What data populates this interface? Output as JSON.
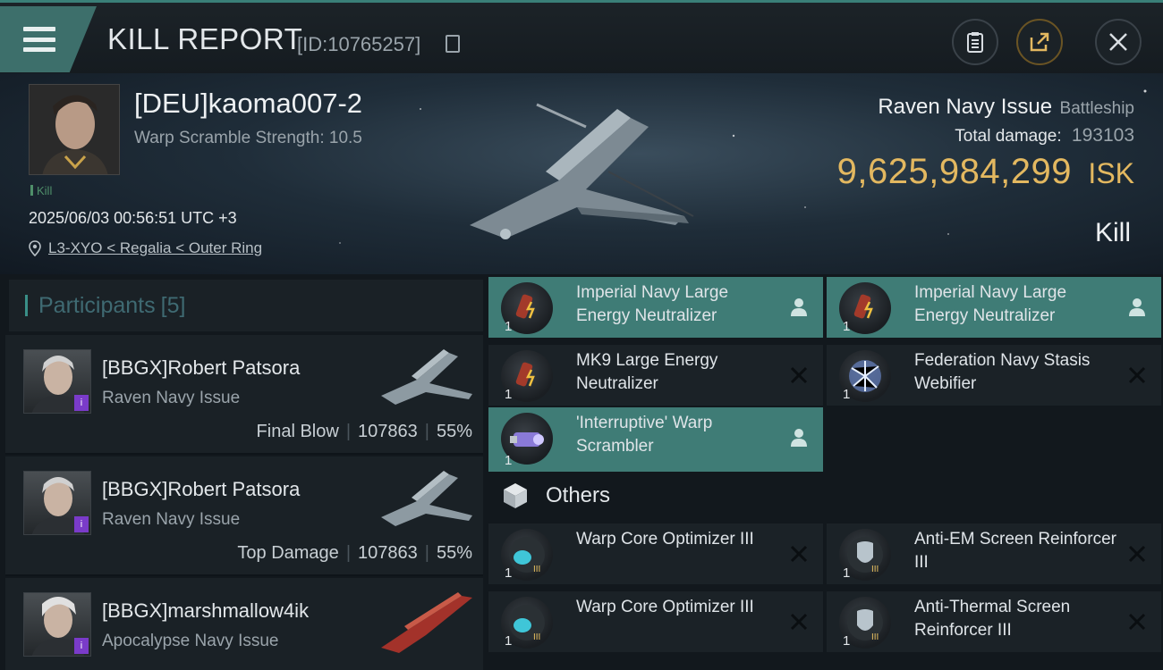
{
  "header": {
    "title": "KILL REPORT",
    "id_text": "[ID:10765257]"
  },
  "victim": {
    "name": "[DEU]kaoma007-2",
    "subtitle": "Warp Scramble Strength: 10.5",
    "tag": "Kill",
    "datetime": "2025/06/03 00:56:51 UTC +3",
    "location": "L3-XYO < Regalia < Outer Ring",
    "ship_name": "Raven Navy Issue",
    "ship_class": "Battleship",
    "total_damage_label": "Total damage:",
    "total_damage": "193103",
    "isk_value": "9,625,984,299",
    "isk_unit": "ISK",
    "result": "Kill"
  },
  "participants": {
    "title": "Participants",
    "count": "[5]",
    "rows": [
      {
        "name": "[BBGX]Robert Patsora",
        "ship": "Raven Navy Issue",
        "role": "Final Blow",
        "damage": "107863",
        "percent": "55%"
      },
      {
        "name": "[BBGX]Robert Patsora",
        "ship": "Raven Navy Issue",
        "role": "Top Damage",
        "damage": "107863",
        "percent": "55%"
      },
      {
        "name": "[BBGX]marshmallow4ik",
        "ship": "Apocalypse Navy Issue"
      }
    ]
  },
  "modules": {
    "items": [
      {
        "label": "Imperial Navy Large Energy Neutralizer",
        "qty": "1"
      },
      {
        "label": "Imperial Navy Large Energy Neutralizer",
        "qty": "1"
      },
      {
        "label": "MK9 Large Energy Neutralizer",
        "qty": "1"
      },
      {
        "label": "Federation Navy Stasis Webifier",
        "qty": "1"
      },
      {
        "label": "'Interruptive' Warp Scrambler",
        "qty": "1"
      }
    ],
    "others_title": "Others",
    "others": [
      {
        "label": "Warp Core Optimizer III",
        "qty": "1"
      },
      {
        "label": "Anti-EM Screen Reinforcer III",
        "qty": "1"
      },
      {
        "label": "Warp Core Optimizer III",
        "qty": "1"
      },
      {
        "label": "Anti-Thermal Screen Reinforcer III",
        "qty": "1"
      }
    ]
  },
  "colors": {
    "accent": "#3f7c76",
    "isk": "#e3b860",
    "badge": "#7a3bc9"
  }
}
